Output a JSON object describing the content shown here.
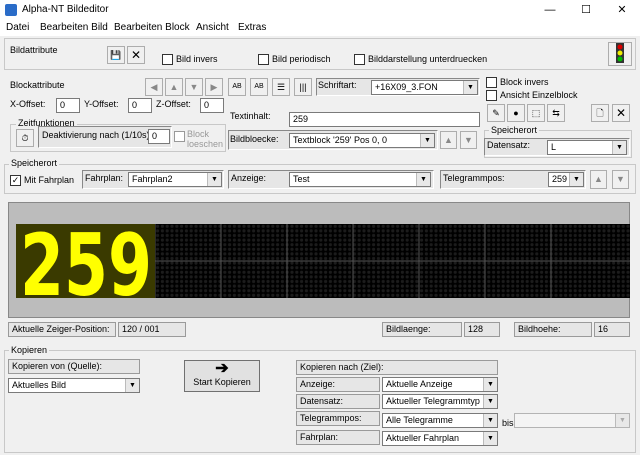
{
  "window": {
    "title": "Alpha-NT Bildeditor",
    "min": "—",
    "max": "☐",
    "close": "✕"
  },
  "menu": [
    "Datei",
    "Bearbeiten Bild",
    "Bearbeiten Block",
    "Ansicht",
    "Extras"
  ],
  "bildattribute": {
    "label": "Bildattribute",
    "bild_invers": "Bild invers",
    "bild_periodisch": "Bild periodisch",
    "bilddarstellung": "Bilddarstellung unterdruecken"
  },
  "blockattribute": {
    "label": "Blockattribute",
    "x_offset_label": "X-Offset:",
    "x_offset": "0",
    "y_offset_label": "Y-Offset:",
    "y_offset": "0",
    "z_offset_label": "Z-Offset:",
    "z_offset": "0",
    "schriftart_label": "Schriftart:",
    "schriftart": "+16X09_3.FON",
    "block_invers": "Block invers",
    "ansicht_einzelblock": "Ansicht Einzelblock"
  },
  "zeitfunktionen": {
    "label": "Zeitfunktionen",
    "deaktivierung_label": "Deaktivierung nach (1/10s):",
    "deaktivierung": "0",
    "block_loeschen": "Block loeschen"
  },
  "textinhalt": {
    "label": "Textinhalt:",
    "value": "259"
  },
  "bildbloecke": {
    "label": "Bildbloecke:",
    "value": "Textblock '259' Pos 0, 0"
  },
  "speicherort_right": {
    "label": "Speicherort",
    "datensatz_label": "Datensatz:",
    "datensatz": "L"
  },
  "speicherort": {
    "label": "Speicherort",
    "mit_fahrplan": "Mit Fahrplan",
    "fahrplan_label": "Fahrplan:",
    "fahrplan": "Fahrplan2",
    "anzeige_label": "Anzeige:",
    "anzeige": "Test",
    "telegrammpos_label": "Telegrammpos:",
    "telegrammpos": "259"
  },
  "display": {
    "digits": "259",
    "color": "#ffff00"
  },
  "status": {
    "zeiger_label": "Aktuelle Zeiger-Position:",
    "zeiger": "120 / 001",
    "bildlaenge_label": "Bildlaenge:",
    "bildlaenge": "128",
    "bildhoehe_label": "Bildhoehe:",
    "bildhoehe": "16"
  },
  "kopieren": {
    "label": "Kopieren",
    "quelle_label": "Kopieren von (Quelle):",
    "quelle": "Aktuelles Bild",
    "start": "Start Kopieren",
    "ziel_label": "Kopieren nach (Ziel):",
    "anzeige_label": "Anzeige:",
    "anzeige": "Aktuelle Anzeige",
    "datensatz_label": "Datensatz:",
    "datensatz": "Aktueller Telegrammtyp",
    "telegrammpos_label": "Telegrammpos:",
    "telegrammpos": "Alle Telegramme",
    "bis_label": "bis",
    "bis": "",
    "fahrplan_label": "Fahrplan:",
    "fahrplan": "Aktueller Fahrplan"
  }
}
